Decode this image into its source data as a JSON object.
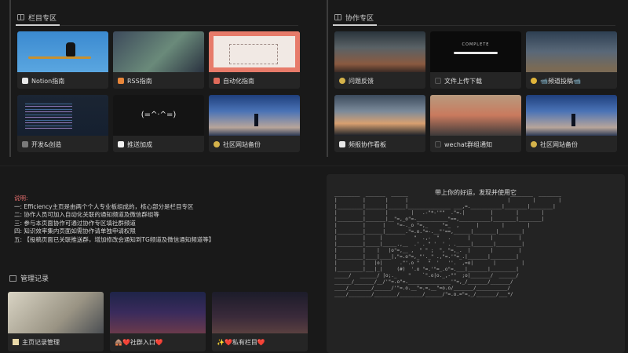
{
  "left_section": {
    "title": "栏目专区",
    "cards": [
      {
        "label": "Notion指南",
        "icon": "notion-icon",
        "icon_color": "#e8e8e8"
      },
      {
        "label": "RSS指南",
        "icon": "rss-icon",
        "icon_color": "#e8863a"
      },
      {
        "label": "自动化指南",
        "icon": "automation-icon",
        "icon_color": "#e06a5a"
      },
      {
        "label": "开发&创造",
        "icon": "code-icon",
        "icon_color": "#7a7a7a"
      },
      {
        "label": "推送加成",
        "icon": "push-icon",
        "icon_color": "#f0f0f0"
      },
      {
        "label": "社区网站备份",
        "icon": "link-icon",
        "icon_color": "#d4b24a"
      }
    ]
  },
  "right_section": {
    "title": "协作专区",
    "cards": [
      {
        "label": "问题反馈",
        "icon": "link-icon",
        "icon_color": "#d4b24a"
      },
      {
        "label": "文件上传下载",
        "icon": "file-icon",
        "icon_color": "#2a2a2a",
        "thumb_text": "COMPLETE"
      },
      {
        "label": "📹频道投稿📹",
        "icon": "bell-icon",
        "icon_color": "#e0b43a"
      },
      {
        "label": "频报协作看板",
        "icon": "send-icon",
        "icon_color": "#e8e8e8"
      },
      {
        "label": "wechat群组通知",
        "icon": "wechat-icon",
        "icon_color": "#2a2a2a"
      },
      {
        "label": "社区网站备份",
        "icon": "link-icon",
        "icon_color": "#d4b24a"
      }
    ]
  },
  "info": {
    "title": "说明:",
    "lines": [
      "一: Efficiency主页是由两个个人专业板组成的，核心部分是栏目专区",
      "二: 协作人员可加入自动化关联的通知频道及微信群组等",
      "三: 参与本页面协作可通过协作专区填社群频道",
      "四: 知识效率集内页面如需协作请单独申请权限",
      "五: 【投稿页面已关联推送群，增加修改会通知到TG频道及微信通知频道等】"
    ]
  },
  "mgmt_section": {
    "title": "管理记录",
    "cards": [
      {
        "label": "主页记录管理",
        "icon": "note-icon",
        "icon_color": "#e8d8a8"
      },
      {
        "label": "🛖❤️社群入口❤️",
        "icon": "house-icon",
        "icon_color": "#c8a070"
      },
      {
        "label": "✨❤️私有栏目❤️",
        "icon": "sparkle-icon",
        "icon_color": "#f0d060"
      }
    ]
  },
  "ascii_panel": {
    "caption": "带上你的好运，发现并使用它"
  }
}
